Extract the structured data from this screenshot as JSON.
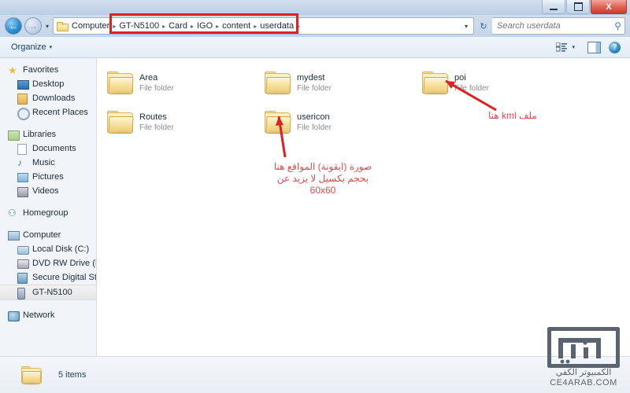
{
  "window": {
    "controls": {
      "minimize_label": "Minimize",
      "maximize_label": "Maximize",
      "close_label": "X"
    }
  },
  "navbar": {
    "back_label": "←",
    "forward_label": "→",
    "recent_caret": "▾",
    "breadcrumbs": [
      {
        "label": "Computer"
      },
      {
        "label": "GT-N5100"
      },
      {
        "label": "Card"
      },
      {
        "label": "IGO"
      },
      {
        "label": "content"
      },
      {
        "label": "userdata"
      }
    ],
    "separator": "▸",
    "dropdown_caret": "▾",
    "refresh_icon": "↻",
    "search": {
      "placeholder": "Search userdata",
      "value": "",
      "icon": "⚲"
    }
  },
  "toolbar": {
    "organize_label": "Organize",
    "organize_caret": "▾",
    "views_caret": "▾",
    "help_label": "?"
  },
  "sidebar": {
    "groups": [
      {
        "header": {
          "label": "Favorites",
          "icon": "star-icon"
        },
        "items": [
          {
            "label": "Desktop",
            "icon": "desktop-icon"
          },
          {
            "label": "Downloads",
            "icon": "downloads-icon"
          },
          {
            "label": "Recent Places",
            "icon": "recent-places-icon"
          }
        ]
      },
      {
        "header": {
          "label": "Libraries",
          "icon": "libraries-icon"
        },
        "items": [
          {
            "label": "Documents",
            "icon": "documents-icon"
          },
          {
            "label": "Music",
            "icon": "music-icon"
          },
          {
            "label": "Pictures",
            "icon": "pictures-icon"
          },
          {
            "label": "Videos",
            "icon": "videos-icon"
          }
        ]
      },
      {
        "header": {
          "label": "Homegroup",
          "icon": "homegroup-icon"
        },
        "items": []
      },
      {
        "header": {
          "label": "Computer",
          "icon": "computer-icon"
        },
        "items": [
          {
            "label": "Local Disk (C:)",
            "icon": "disk-icon"
          },
          {
            "label": "DVD RW Drive (D:) P",
            "icon": "dvd-icon"
          },
          {
            "label": "Secure Digital Storag",
            "icon": "sd-card-icon"
          },
          {
            "label": "GT-N5100",
            "icon": "phone-icon",
            "selected": true
          }
        ]
      },
      {
        "header": {
          "label": "Network",
          "icon": "network-icon"
        },
        "items": []
      }
    ]
  },
  "content": {
    "items": [
      {
        "name": "Area",
        "type": "File folder"
      },
      {
        "name": "mydest",
        "type": "File folder"
      },
      {
        "name": "poi",
        "type": "File folder"
      },
      {
        "name": "Routes",
        "type": "File folder"
      },
      {
        "name": "usericon",
        "type": "File folder"
      }
    ]
  },
  "statusbar": {
    "item_count_text": "5 items"
  },
  "annotations": {
    "accent_color": "#e02020",
    "text_color": "#e34b4b",
    "kml_note": "ملف kml هنا",
    "usericon_note_line1": "صورة (ايقونة) المواقع هنا",
    "usericon_note_line2": "بحجم بكسيل لا يزيد عن",
    "usericon_note_line3": "60x60"
  },
  "watermark": {
    "arabic": "الكمبيوتر الكفي",
    "url": "CE4ARAB.COM"
  }
}
